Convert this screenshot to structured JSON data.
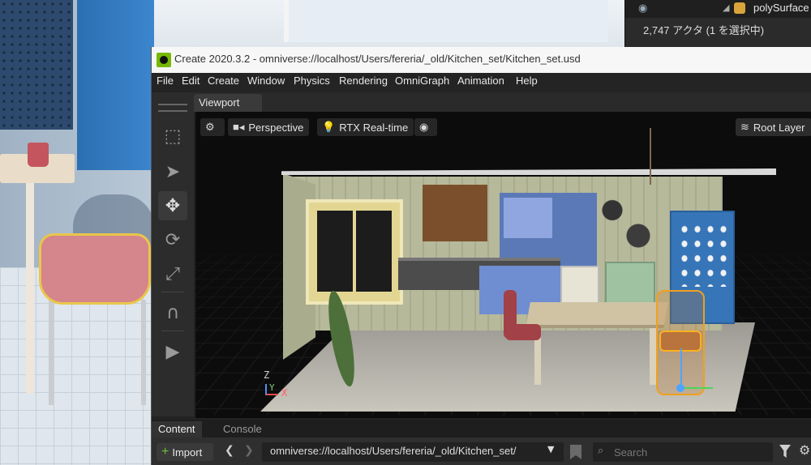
{
  "background_window": {
    "stage": {
      "item_name": "polySurface",
      "count_text": "2,747 アクタ (1 を選択中)"
    }
  },
  "window": {
    "title": "Create 2020.3.2 - omniverse://localhost/Users/fereria/_old/Kitchen_set/Kitchen_set.usd"
  },
  "menu": [
    "File",
    "Edit",
    "Create",
    "Window",
    "Physics",
    "Rendering",
    "OmniGraph",
    "Animation",
    "Help"
  ],
  "toolbar": {
    "tools": [
      {
        "name": "select-box-icon",
        "active": false
      },
      {
        "name": "select-arrow-icon",
        "active": false
      },
      {
        "name": "move-icon",
        "active": true
      },
      {
        "name": "rotate-icon",
        "active": false
      },
      {
        "name": "scale-icon",
        "active": false
      },
      {
        "name": "snap-magnet-icon",
        "active": false
      },
      {
        "name": "play-icon",
        "active": false
      }
    ]
  },
  "viewport": {
    "tab_label": "Viewport",
    "camera_label": "Perspective",
    "render_label": "RTX Real-time",
    "root_layer_label": "Root Layer",
    "axis": {
      "z": "Z",
      "y": "Y",
      "x": "X"
    }
  },
  "content": {
    "tabs": [
      "Content",
      "Console"
    ],
    "import_label": "Import",
    "path": "omniverse://localhost/Users/fereria/_old/Kitchen_set/",
    "search_placeholder": "Search"
  }
}
